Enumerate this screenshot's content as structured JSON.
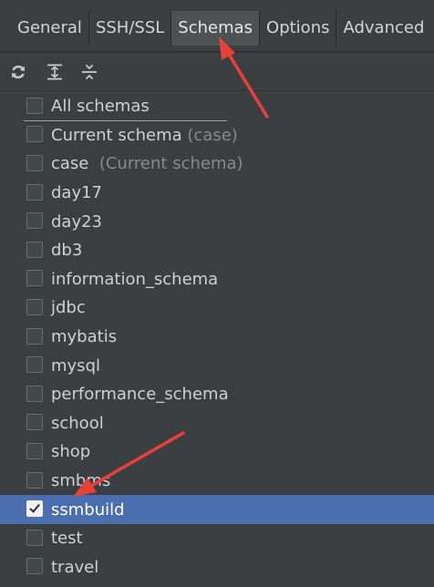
{
  "tabs": [
    {
      "label": "General",
      "active": false
    },
    {
      "label": "SSH/SSL",
      "active": false
    },
    {
      "label": "Schemas",
      "active": true
    },
    {
      "label": "Options",
      "active": false
    },
    {
      "label": "Advanced",
      "active": false
    }
  ],
  "toolbar": {
    "icons": [
      "refresh-icon",
      "expand-all-icon",
      "collapse-all-icon"
    ]
  },
  "schemas": [
    {
      "label": "All schemas",
      "hint": "",
      "checked": false
    },
    {
      "label": "Current schema",
      "hint": "(case)",
      "checked": false
    },
    {
      "label": "case",
      "hint": "(Current schema)",
      "checked": false
    },
    {
      "label": "day17",
      "hint": "",
      "checked": false
    },
    {
      "label": "day23",
      "hint": "",
      "checked": false
    },
    {
      "label": "db3",
      "hint": "",
      "checked": false
    },
    {
      "label": "information_schema",
      "hint": "",
      "checked": false
    },
    {
      "label": "jdbc",
      "hint": "",
      "checked": false
    },
    {
      "label": "mybatis",
      "hint": "",
      "checked": false
    },
    {
      "label": "mysql",
      "hint": "",
      "checked": false
    },
    {
      "label": "performance_schema",
      "hint": "",
      "checked": false
    },
    {
      "label": "school",
      "hint": "",
      "checked": false
    },
    {
      "label": "shop",
      "hint": "",
      "checked": false
    },
    {
      "label": "smbms",
      "hint": "",
      "checked": false
    },
    {
      "label": "ssmbuild",
      "hint": "",
      "checked": true
    },
    {
      "label": "test",
      "hint": "",
      "checked": false
    },
    {
      "label": "travel",
      "hint": "",
      "checked": false
    }
  ],
  "colors": {
    "background": "#3c3f41",
    "selection": "#4b6eaf",
    "annotation_arrow": "#e8403b"
  }
}
